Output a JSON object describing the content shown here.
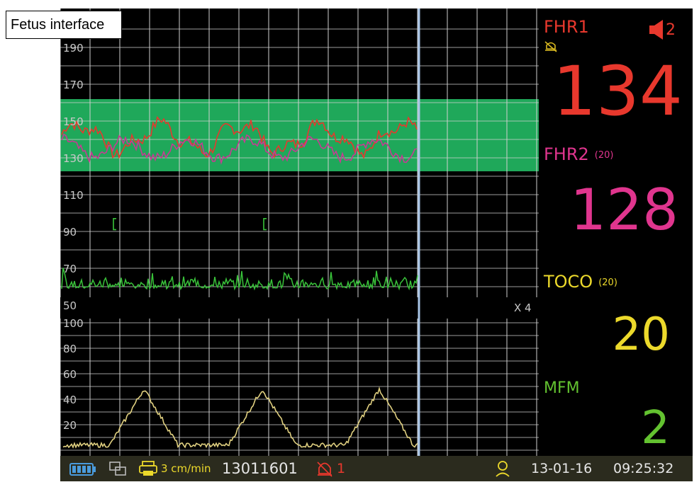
{
  "caption": "Fetus interface",
  "fhr_axis_ticks": [
    "190",
    "170",
    "150",
    "130",
    "110",
    "90",
    "70",
    "50"
  ],
  "toco_axis_ticks": [
    "100",
    "80",
    "60",
    "40",
    "20"
  ],
  "scale_marker": "X 4",
  "panel": {
    "fhr1": {
      "label": "FHR1",
      "value": "134",
      "volume": "2",
      "color": "#e8382d"
    },
    "fhr2": {
      "label": "FHR2",
      "sub": "(20)",
      "value": "128",
      "color": "#e0358e"
    },
    "toco": {
      "label": "TOCO",
      "sub": "(20)",
      "value": "20",
      "color": "#ecd92b"
    },
    "mfm": {
      "label": "MFM",
      "value": "2",
      "color": "#63c230"
    }
  },
  "status": {
    "speed": "3 cm/min",
    "record_id": "13011601",
    "alarm_count": "1",
    "date": "13-01-16",
    "time": "09:25:32"
  },
  "colors": {
    "safe_band": "#1fa85a",
    "grid": "#d0d0d0",
    "cursor": "#a9c6e8",
    "fhr1_trace": "#e8382d",
    "fhr2_trace": "#c83a94",
    "fm_trace": "#39c23a",
    "toco_trace": "#e0d080"
  },
  "icons": [
    "battery-icon",
    "network-icon",
    "printer-icon",
    "alarm-bell-icon",
    "user-icon",
    "speaker-icon",
    "alarm-mute-icon"
  ]
}
